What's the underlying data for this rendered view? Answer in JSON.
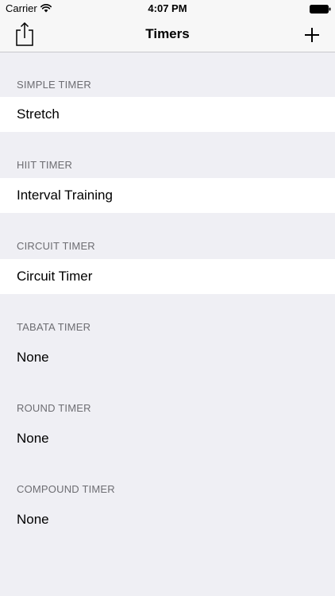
{
  "status_bar": {
    "carrier": "Carrier",
    "time": "4:07 PM"
  },
  "nav": {
    "title": "Timers",
    "left_icon": "share-icon",
    "right_icon": "plus-icon",
    "accent_color": "#000000"
  },
  "sections": [
    {
      "header": "SIMPLE TIMER",
      "items": [
        "Stretch"
      ],
      "filled": true
    },
    {
      "header": "HIIT TIMER",
      "items": [
        "Interval Training"
      ],
      "filled": true
    },
    {
      "header": "CIRCUIT TIMER",
      "items": [
        "Circuit Timer"
      ],
      "filled": true
    },
    {
      "header": "TABATA TIMER",
      "items": [
        "None"
      ],
      "filled": false
    },
    {
      "header": "ROUND TIMER",
      "items": [
        "None"
      ],
      "filled": false
    },
    {
      "header": "COMPOUND TIMER",
      "items": [
        "None"
      ],
      "filled": false
    }
  ],
  "colors": {
    "background": "#efeff4",
    "row_background": "#ffffff",
    "header_text": "#6d6d72"
  }
}
